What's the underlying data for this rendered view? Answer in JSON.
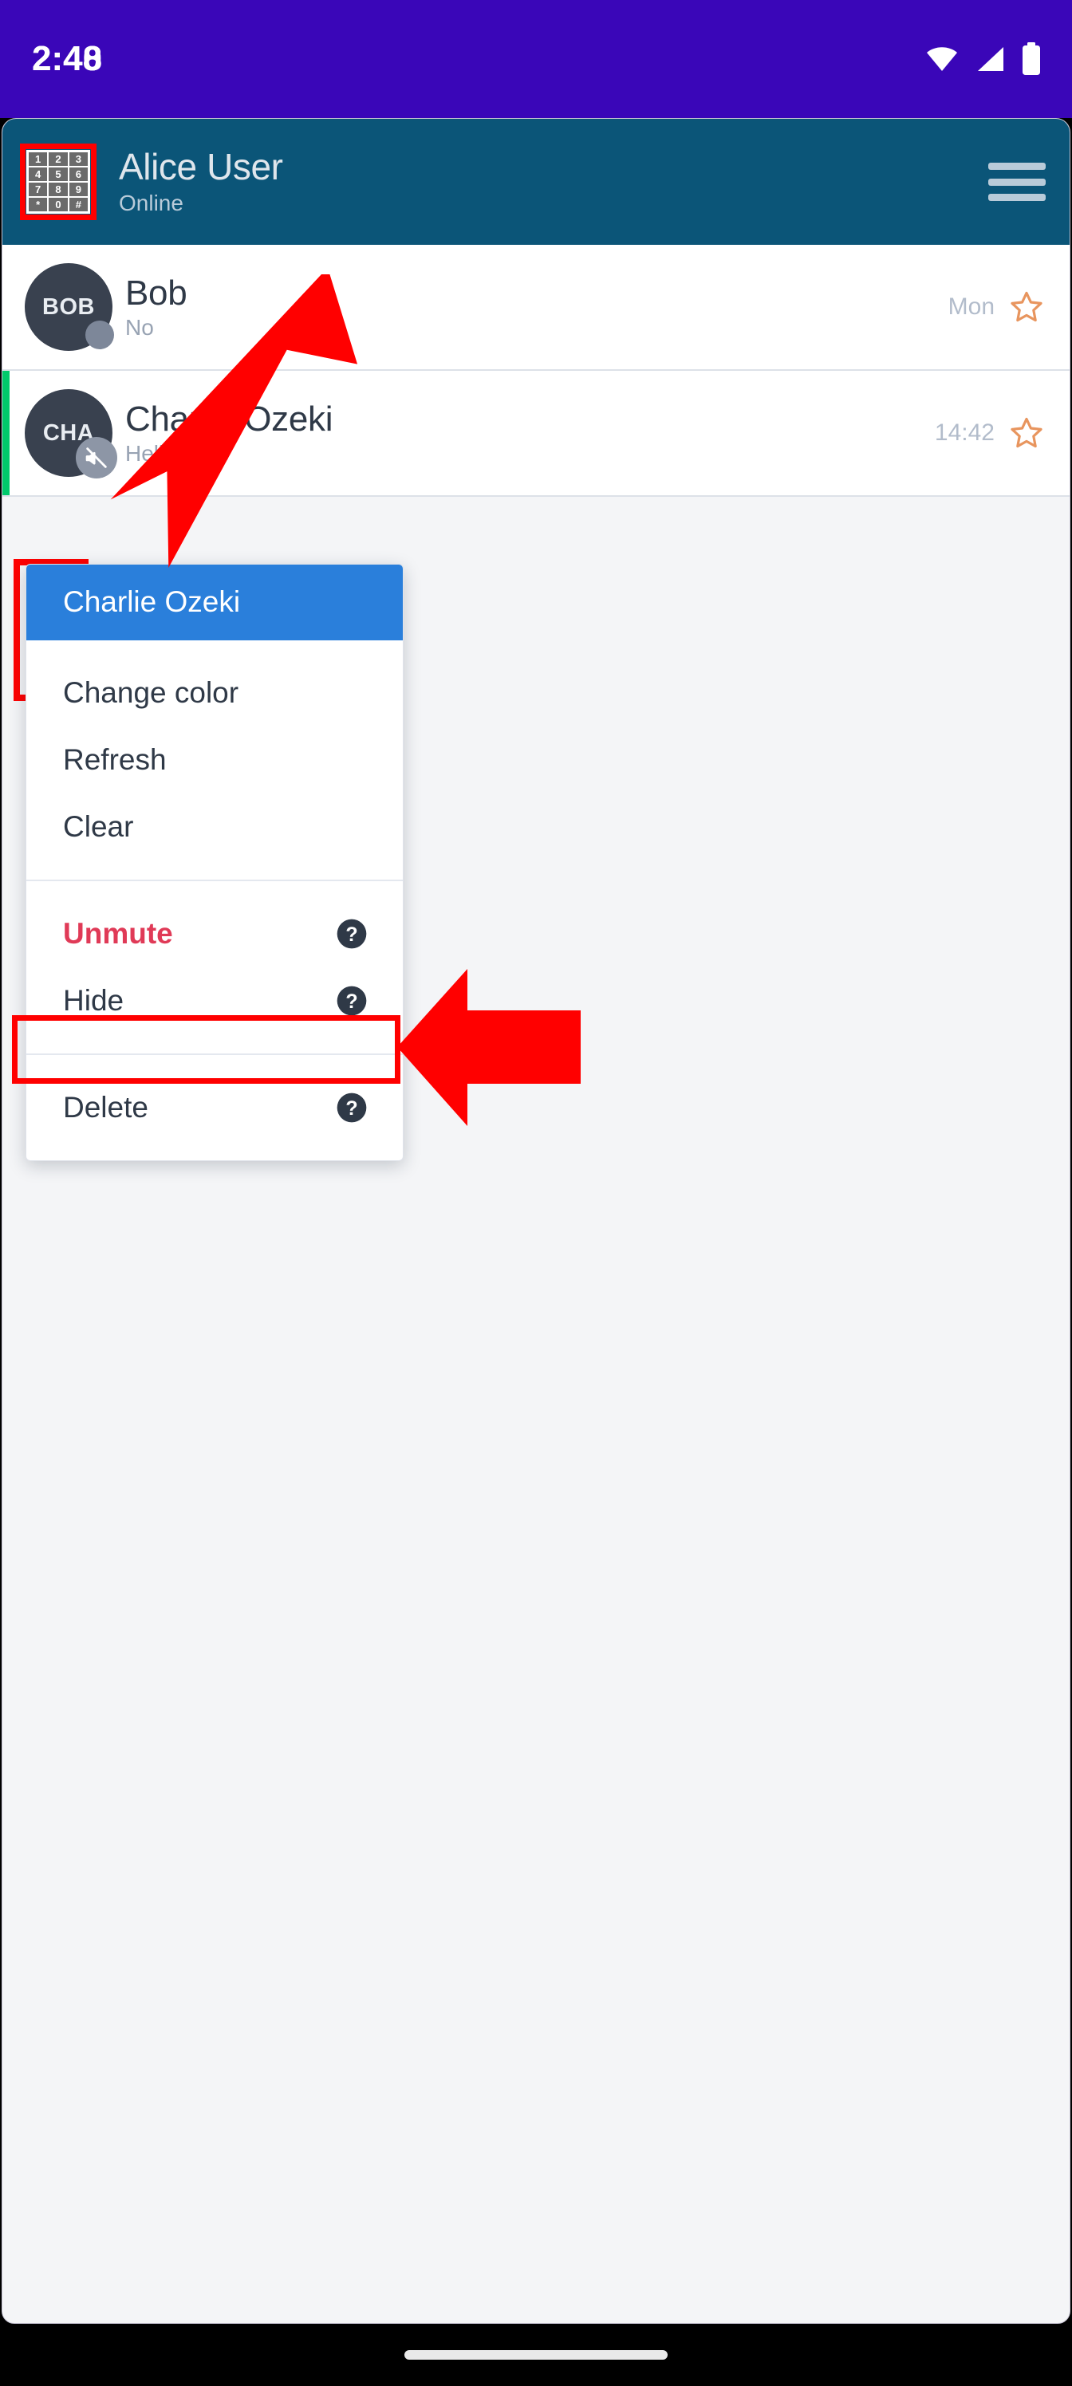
{
  "status_bar": {
    "time": "2:40",
    "time_ghost": "2:48",
    "icons": [
      "wifi-icon",
      "cellular-signal-icon",
      "battery-icon"
    ],
    "background": "#3A06B8"
  },
  "app_header": {
    "title": "Alice User",
    "status": "Online",
    "avatar_icon": "dialpad-icon",
    "dialpad_keys": [
      "1",
      "2",
      "3",
      "4",
      "5",
      "6",
      "7",
      "8",
      "9",
      "*",
      "0",
      "#"
    ],
    "menu_icon": "hamburger-menu-icon",
    "background": "#0b5578",
    "highlighted": true,
    "highlight_color": "#ff0000"
  },
  "contacts": [
    {
      "initials": "BOB",
      "name": "Bob",
      "preview": "No",
      "time": "Mon",
      "favorite_icon": "star-outline-icon",
      "presence": "offline",
      "presence_color": "#7d8799",
      "muted": false,
      "accent": false
    },
    {
      "initials": "CHA",
      "name": "Charlie Ozeki",
      "preview": "Hello Alice",
      "time": "14:42",
      "favorite_icon": "star-outline-icon",
      "presence": "muted",
      "presence_color": "#8d96a6",
      "muted": true,
      "mute_icon": "volume-off-icon",
      "accent": true,
      "accent_color": "#00c96b"
    }
  ],
  "context_menu": {
    "header": "Charlie Ozeki",
    "header_background": "#2a7fdb",
    "groups": [
      {
        "items": [
          {
            "label": "Change color",
            "help": false
          },
          {
            "label": "Refresh",
            "help": false
          },
          {
            "label": "Clear",
            "help": false
          }
        ]
      },
      {
        "items": [
          {
            "label": "Unmute",
            "help": true,
            "help_icon": "question-mark-icon",
            "danger": true,
            "highlighted": true,
            "color": "#e03a57"
          },
          {
            "label": "Hide",
            "help": true,
            "help_icon": "question-mark-icon"
          }
        ]
      },
      {
        "items": [
          {
            "label": "Delete",
            "help": true,
            "help_icon": "question-mark-icon"
          }
        ]
      }
    ]
  },
  "annotations": [
    {
      "name": "arrow-to-avatar",
      "type": "arrow-diagonal-down-left",
      "color": "#ff0000"
    },
    {
      "name": "arrow-to-unmute",
      "type": "arrow-left",
      "color": "#ff0000"
    }
  ],
  "nav_bar": {
    "gesture_pill": "home-gesture-pill"
  }
}
